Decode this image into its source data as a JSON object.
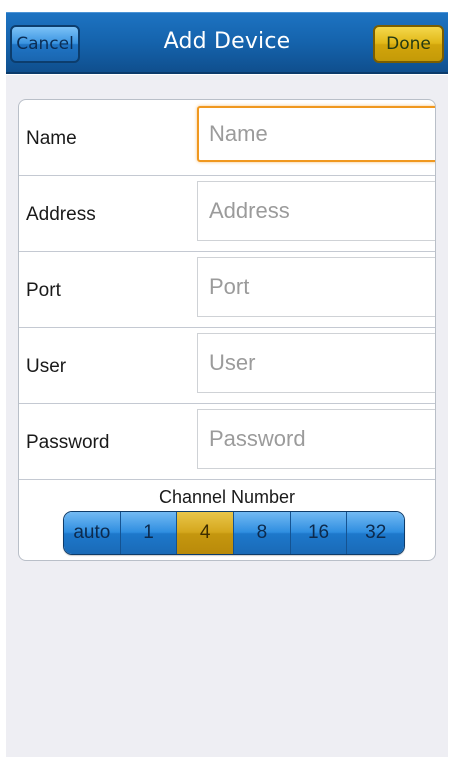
{
  "navbar": {
    "title": "Add Device",
    "cancel_label": "Cancel",
    "done_label": "Done"
  },
  "form": {
    "fields": [
      {
        "label": "Name",
        "placeholder": "Name",
        "value": ""
      },
      {
        "label": "Address",
        "placeholder": "Address",
        "value": ""
      },
      {
        "label": "Port",
        "placeholder": "Port",
        "value": ""
      },
      {
        "label": "User",
        "placeholder": "User",
        "value": ""
      },
      {
        "label": "Password",
        "placeholder": "Password",
        "value": ""
      }
    ],
    "focused_field": "Name"
  },
  "channel": {
    "label": "Channel Number",
    "options": [
      "auto",
      "1",
      "4",
      "8",
      "16",
      "32"
    ],
    "selected": "4"
  },
  "colors": {
    "navbar": "#1563ac",
    "done_button": "#e1b717",
    "cancel_button": "#3a94e1",
    "focus_border": "#f0981f",
    "background": "#eeeef3"
  }
}
